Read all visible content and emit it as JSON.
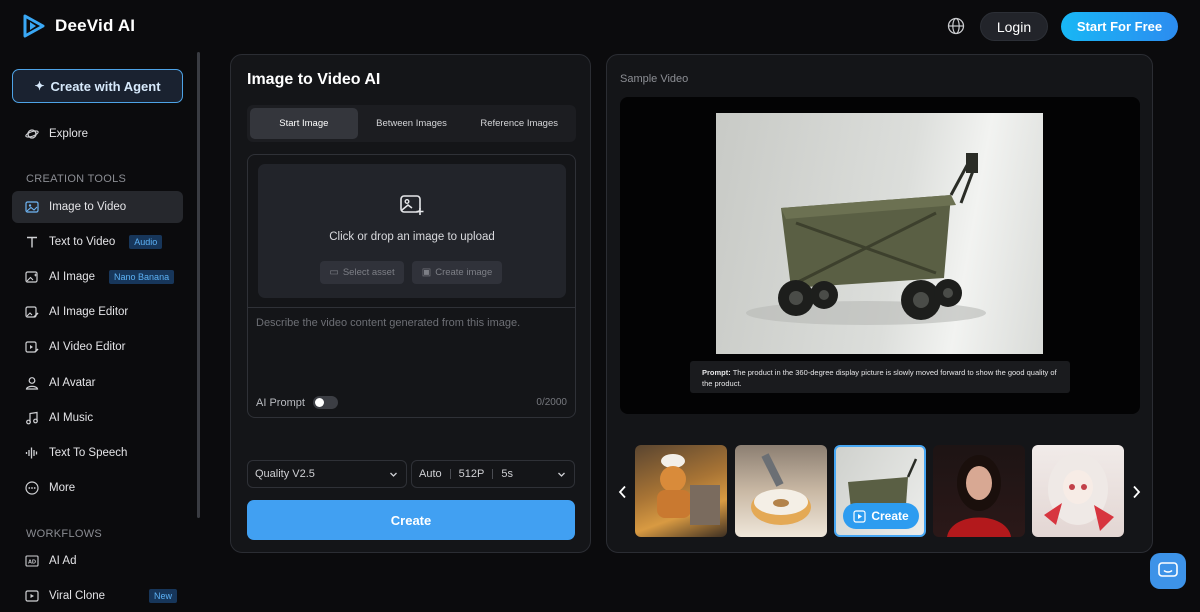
{
  "header": {
    "logo_text": "DeeVid AI",
    "login_label": "Login",
    "start_label": "Start For Free"
  },
  "sidebar": {
    "agent_button": "Create with Agent",
    "explore": "Explore",
    "creation_tools_label": "CREATION TOOLS",
    "items": [
      {
        "label": "Image to Video",
        "badge": "",
        "icon": "image-icon"
      },
      {
        "label": "Text to Video",
        "badge": "Audio",
        "icon": "text-icon"
      },
      {
        "label": "AI Image",
        "badge": "Nano Banana",
        "icon": "image-sparkle-icon"
      },
      {
        "label": "AI Image Editor",
        "badge": "",
        "icon": "image-edit-icon"
      },
      {
        "label": "AI Video Editor",
        "badge": "",
        "icon": "video-edit-icon"
      },
      {
        "label": "AI Avatar",
        "badge": "",
        "icon": "avatar-icon"
      },
      {
        "label": "AI Music",
        "badge": "",
        "icon": "music-icon"
      },
      {
        "label": "Text To Speech",
        "badge": "",
        "icon": "waveform-icon"
      },
      {
        "label": "More",
        "badge": "",
        "icon": "more-icon"
      }
    ],
    "workflows_label": "WORKFLOWS",
    "workflows": [
      {
        "label": "AI Ad",
        "badge": ""
      },
      {
        "label": "Viral Clone",
        "badge": "New"
      }
    ]
  },
  "main": {
    "title": "Image to Video AI",
    "tabs": [
      "Start Image",
      "Between Images",
      "Reference Images"
    ],
    "active_tab": "Start Image",
    "upload_text": "Click or drop an image to upload",
    "select_asset": "Select asset",
    "create_image": "Create image",
    "prompt_placeholder": "Describe the video content generated from this image.",
    "ai_prompt_label": "AI Prompt",
    "counter": "0/2000",
    "quality": "Quality V2.5",
    "ratio": "Auto",
    "resolution": "512P",
    "duration": "5s",
    "create_label": "Create"
  },
  "sample": {
    "label": "Sample Video",
    "prompt_prefix": "Prompt:",
    "prompt_text": "The product in the 360-degree display picture is slowly moved forward to show the good quality of the product.",
    "thumb_create": "Create"
  },
  "colors": {
    "accent": "#41a0f2",
    "badge_bg": "#17365a",
    "badge_text": "#5cb1f5"
  }
}
